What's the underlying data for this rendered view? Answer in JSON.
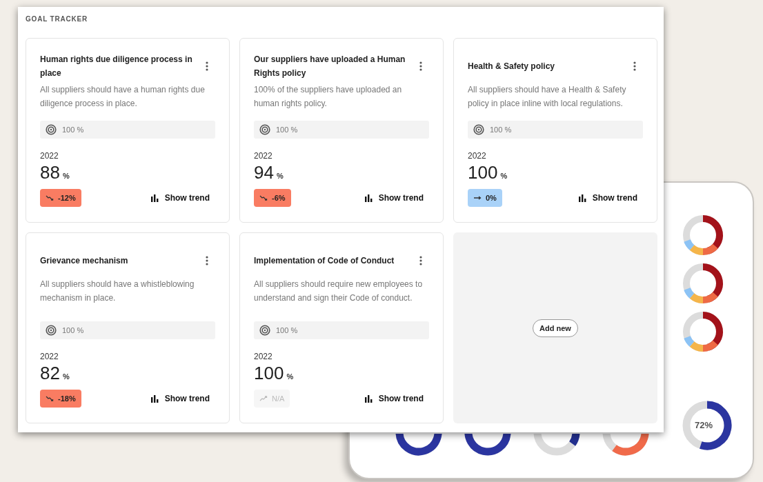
{
  "section_title": "GOAL TRACKER",
  "goals": [
    {
      "title": "Human rights due diligence process in place",
      "description": "All suppliers should have a human rights due diligence process in place.",
      "target": "100 %",
      "year": "2022",
      "value": "88",
      "unit": "%",
      "trend": {
        "kind": "down",
        "label": "-12%"
      },
      "action": "Show trend"
    },
    {
      "title": "Our suppliers have uploaded a Human Rights policy",
      "description": "100% of the suppliers have uploaded an human rights policy.",
      "target": "100 %",
      "year": "2022",
      "value": "94",
      "unit": "%",
      "trend": {
        "kind": "down",
        "label": "-6%"
      },
      "action": "Show trend"
    },
    {
      "title": "Health & Safety policy",
      "description": "All suppliers should have a Health & Safety policy in place inline with local regulations.",
      "target": "100 %",
      "year": "2022",
      "value": "100",
      "unit": "%",
      "trend": {
        "kind": "flat",
        "label": "0%"
      },
      "action": "Show trend"
    },
    {
      "title": "Grievance mechanism",
      "description": "All suppliers should have a whistleblowing mechanism in place.",
      "target": "100 %",
      "year": "2022",
      "value": "82",
      "unit": "%",
      "trend": {
        "kind": "down",
        "label": "-18%"
      },
      "action": "Show trend"
    },
    {
      "title": "Implementation of Code of Conduct",
      "description": "All suppliers should require new employees to understand and sign their Code of conduct.",
      "target": "100 %",
      "year": "2022",
      "value": "100",
      "unit": "%",
      "trend": {
        "kind": "na",
        "label": "N/A"
      },
      "action": "Show trend"
    }
  ],
  "add_new": "Add new",
  "background_device": {
    "gauge_reading": "72%"
  }
}
